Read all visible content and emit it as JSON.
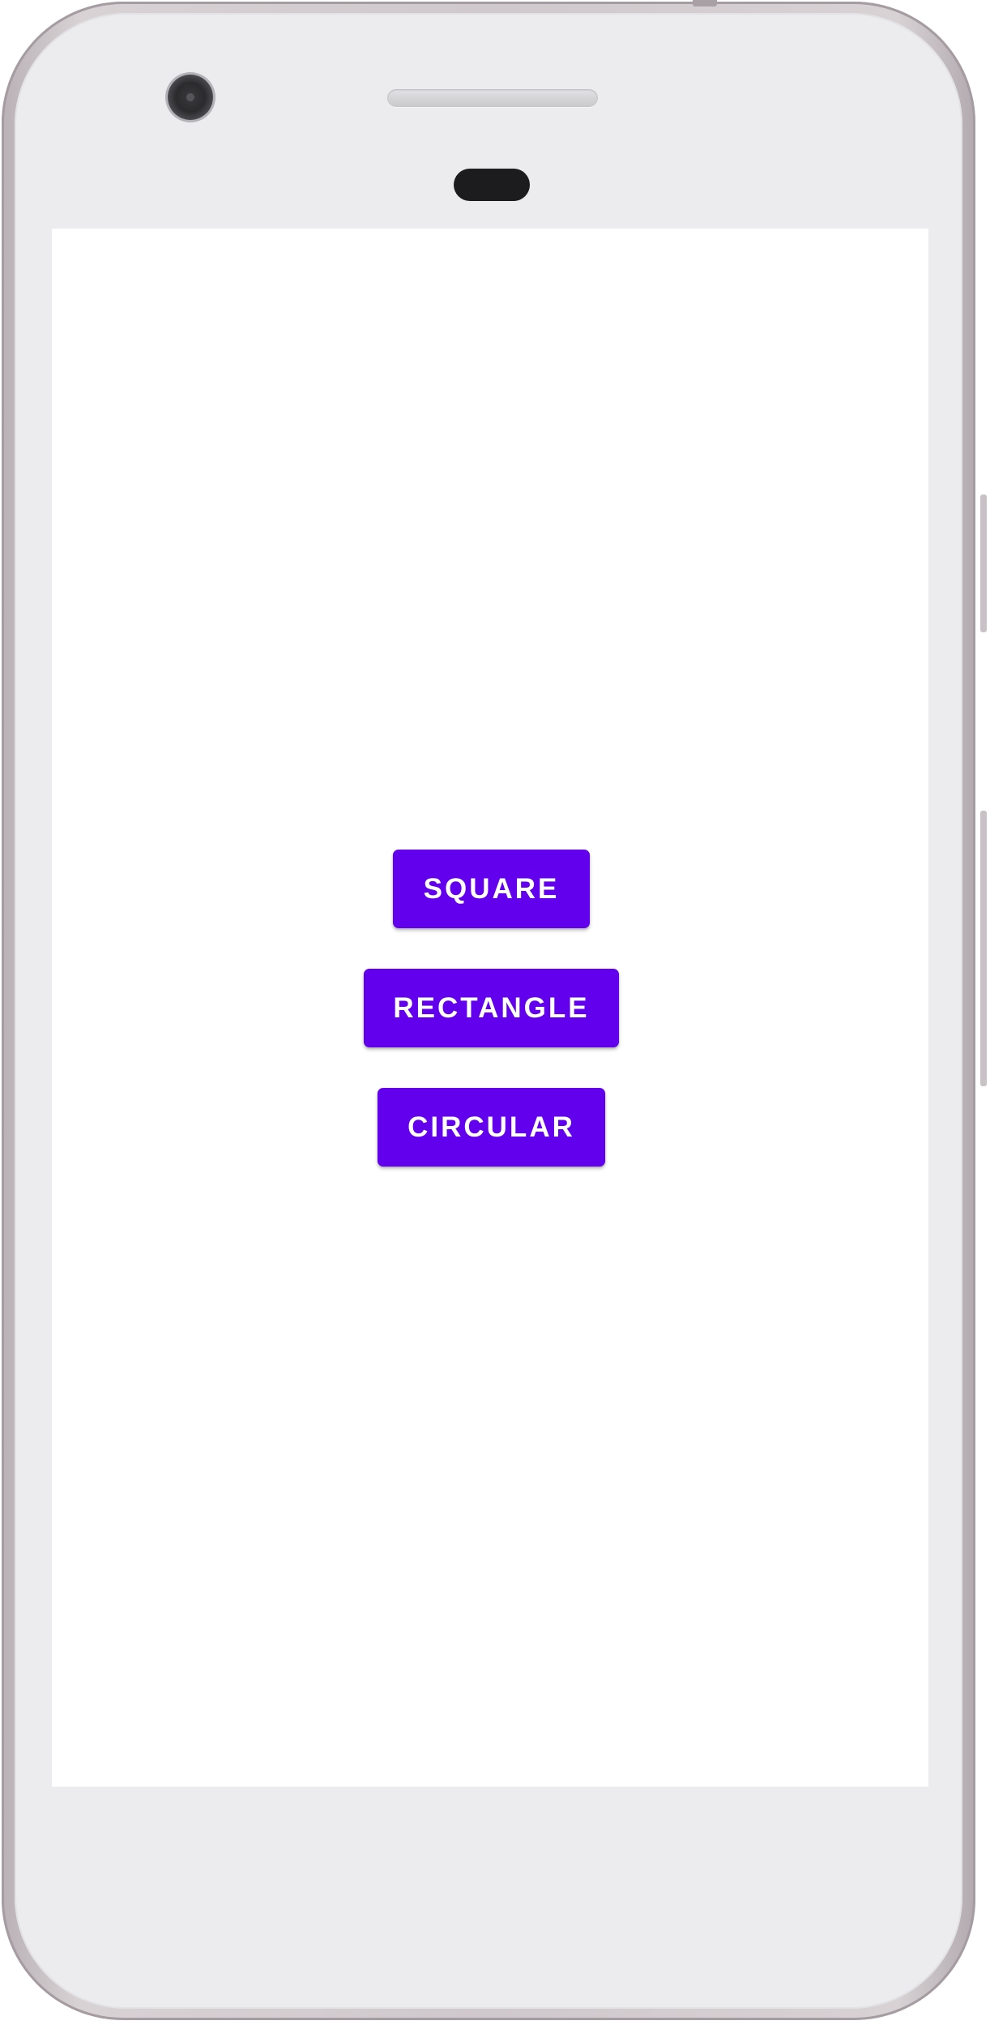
{
  "device": {
    "frame_color": "#cfc8cc",
    "face_color": "#ececee",
    "icons": [
      "front-camera-icon",
      "speaker-icon",
      "proximity-sensor-icon"
    ]
  },
  "screen": {
    "background": "#ffffff",
    "buttons": [
      {
        "label": "SQUARE"
      },
      {
        "label": "RECTANGLE"
      },
      {
        "label": "CIRCULAR"
      }
    ],
    "accent_color": "#6200ee",
    "button_text_color": "#ffffff"
  }
}
